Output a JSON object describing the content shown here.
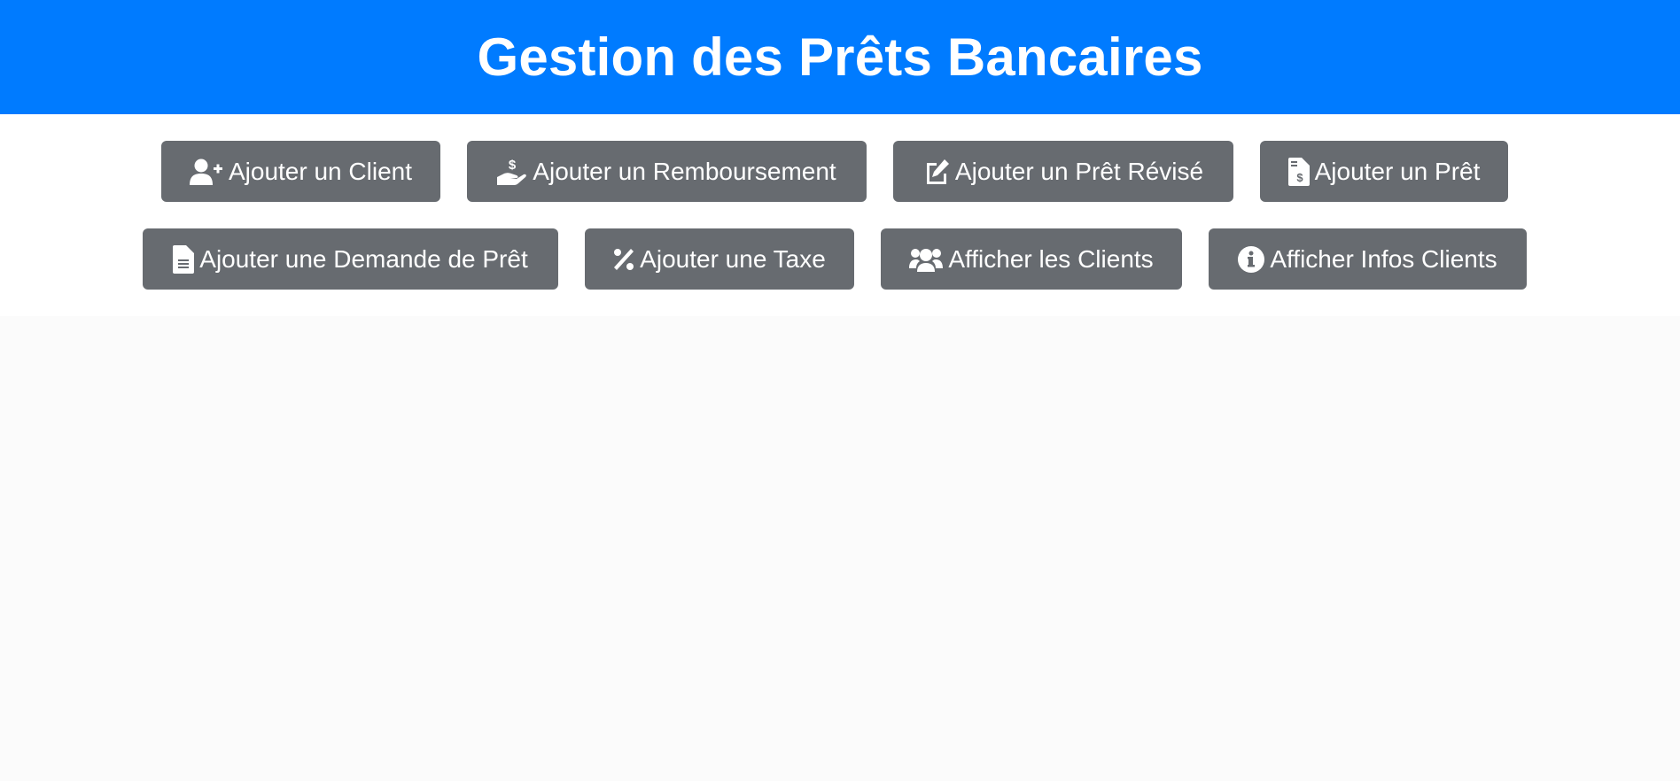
{
  "header": {
    "title": "Gestion des Prêts Bancaires",
    "background_color": "#007bff"
  },
  "buttons": {
    "add_client": {
      "label": "Ajouter un Client",
      "icon": "user-plus-icon"
    },
    "add_repayment": {
      "label": "Ajouter un Remboursement",
      "icon": "hand-holding-dollar-icon"
    },
    "add_revised_loan": {
      "label": "Ajouter un Prêt Révisé",
      "icon": "pen-to-square-icon"
    },
    "add_loan": {
      "label": "Ajouter un Prêt",
      "icon": "file-invoice-dollar-icon"
    },
    "add_loan_request": {
      "label": "Ajouter une Demande de Prêt",
      "icon": "file-lines-icon"
    },
    "add_tax": {
      "label": "Ajouter une Taxe",
      "icon": "percent-icon"
    },
    "show_clients": {
      "label": "Afficher les Clients",
      "icon": "users-icon"
    },
    "show_client_info": {
      "label": "Afficher Infos Clients",
      "icon": "circle-info-icon"
    }
  },
  "colors": {
    "button_background": "#676b70",
    "button_text": "#ffffff",
    "page_background": "#fbfbfb"
  }
}
